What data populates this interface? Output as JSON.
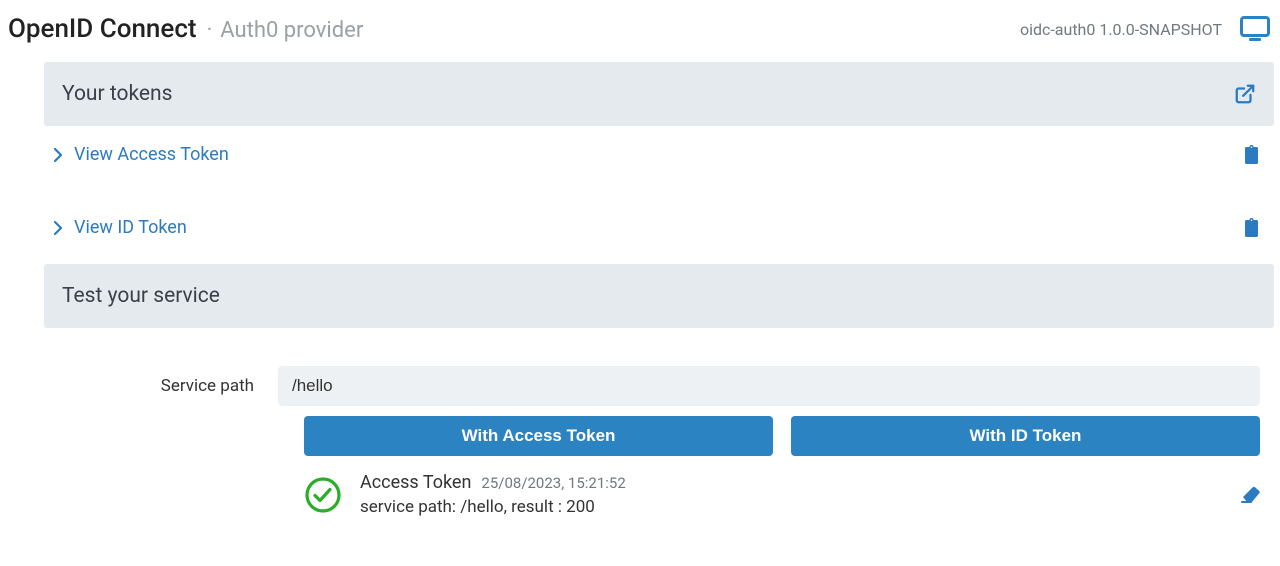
{
  "header": {
    "title": "OpenID Connect",
    "separator": "·",
    "subtitle": "Auth0 provider",
    "version": "oidc-auth0 1.0.0-SNAPSHOT"
  },
  "tokens_section": {
    "title": "Your tokens",
    "access_token_link": "View Access Token",
    "id_token_link": "View ID Token"
  },
  "test_section": {
    "title": "Test your service",
    "service_path_label": "Service path",
    "service_path_value": "/hello",
    "button_access": "With Access Token",
    "button_id": "With ID Token"
  },
  "result": {
    "token_type": "Access Token",
    "timestamp": "25/08/2023, 15:21:52",
    "detail": "service path: /hello, result : 200"
  },
  "colors": {
    "link": "#2c7bc0",
    "button": "#2c83c1",
    "section_bg": "#e5eaef",
    "muted": "#707880",
    "success": "#2bac2b"
  }
}
